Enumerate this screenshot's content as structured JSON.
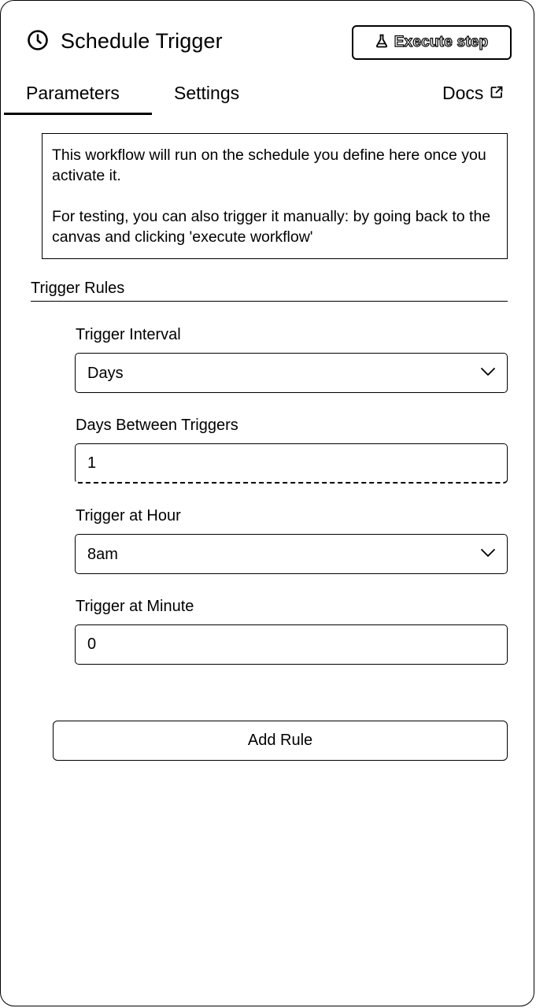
{
  "header": {
    "title": "Schedule Trigger",
    "icon": "clock-icon",
    "execute_button": {
      "label": "Execute step",
      "icon": "flask-icon"
    }
  },
  "tabs": {
    "parameters": "Parameters",
    "settings": "Settings",
    "docs": "Docs",
    "docs_icon": "external-link-icon",
    "active": "parameters"
  },
  "notice": {
    "line1": "This workflow will run on the schedule you define here once you activate it.",
    "line2": "For testing, you can also trigger it manually: by going back to the canvas and clicking 'execute workflow'"
  },
  "trigger_rules": {
    "title": "Trigger Rules",
    "fields": {
      "interval": {
        "label": "Trigger Interval",
        "value": "Days",
        "type": "select"
      },
      "days_between": {
        "label": "Days Between Triggers",
        "value": "1",
        "type": "number"
      },
      "hour": {
        "label": "Trigger at Hour",
        "value": "8am",
        "type": "select"
      },
      "minute": {
        "label": "Trigger at Minute",
        "value": "0",
        "type": "number"
      }
    },
    "add_rule_label": "Add Rule"
  }
}
